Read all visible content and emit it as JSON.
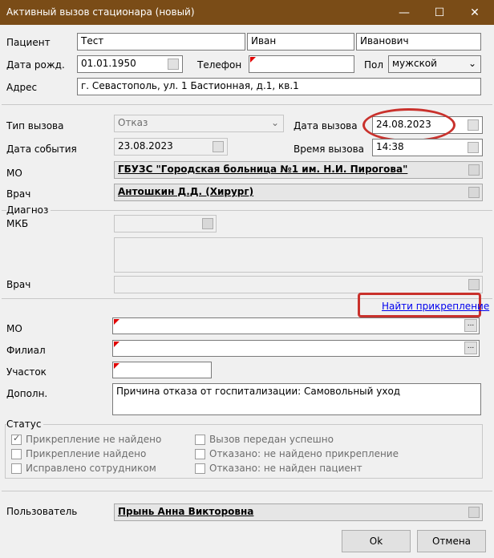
{
  "window": {
    "title": "Активный вызов стационара (новый)"
  },
  "patient": {
    "label": "Пациент",
    "last_name": "Тест",
    "first_name": "Иван",
    "middle_name": "Иванович",
    "dob_label": "Дата рожд.",
    "dob": "01.01.1950",
    "phone_label": "Телефон",
    "phone": "",
    "sex_label": "Пол",
    "sex": "мужской",
    "address_label": "Адрес",
    "address": "г. Севастополь, ул. 1 Бастионная, д.1, кв.1"
  },
  "call": {
    "type_label": "Тип вызова",
    "type": "Отказ",
    "call_date_label": "Дата вызова",
    "call_date": "24.08.2023",
    "event_date_label": "Дата события",
    "event_date": "23.08.2023",
    "call_time_label": "Время вызова",
    "call_time": "14:38",
    "mo_label": "МО",
    "mo": "ГБУЗС \"Городская больница №1 им. Н.И. Пирогова\"",
    "doctor_label": "Врач",
    "doctor": "Антошкин Д.Д. (Хирург)"
  },
  "diagnosis": {
    "group_label": "Диагноз",
    "mkb_label": "МКБ",
    "mkb": "",
    "doctor_label": "Врач",
    "doctor": ""
  },
  "attachment": {
    "find_link": "Найти прикрепление",
    "mo_label": "МО",
    "branch_label": "Филиал",
    "district_label": "Участок",
    "extra_label": "Дополн.",
    "extra": "Причина отказа от госпитализации: Самовольный уход"
  },
  "status": {
    "group_label": "Статус",
    "items": [
      {
        "label": "Прикрепление не найдено",
        "checked": true
      },
      {
        "label": "Прикрепление найдено",
        "checked": false
      },
      {
        "label": "Исправлено сотрудником",
        "checked": false
      },
      {
        "label": "Вызов передан успешно",
        "checked": false
      },
      {
        "label": "Отказано: не найдено прикрепление",
        "checked": false
      },
      {
        "label": "Отказано: не найден пациент",
        "checked": false
      }
    ]
  },
  "user": {
    "label": "Пользователь",
    "name": "Прынь Анна Викторовна"
  },
  "buttons": {
    "ok": "Ok",
    "cancel": "Отмена"
  },
  "colors": {
    "titlebar": "#7a4c17",
    "highlight": "#c9312c",
    "link": "#0000ee",
    "required_mark": "#e00000"
  }
}
